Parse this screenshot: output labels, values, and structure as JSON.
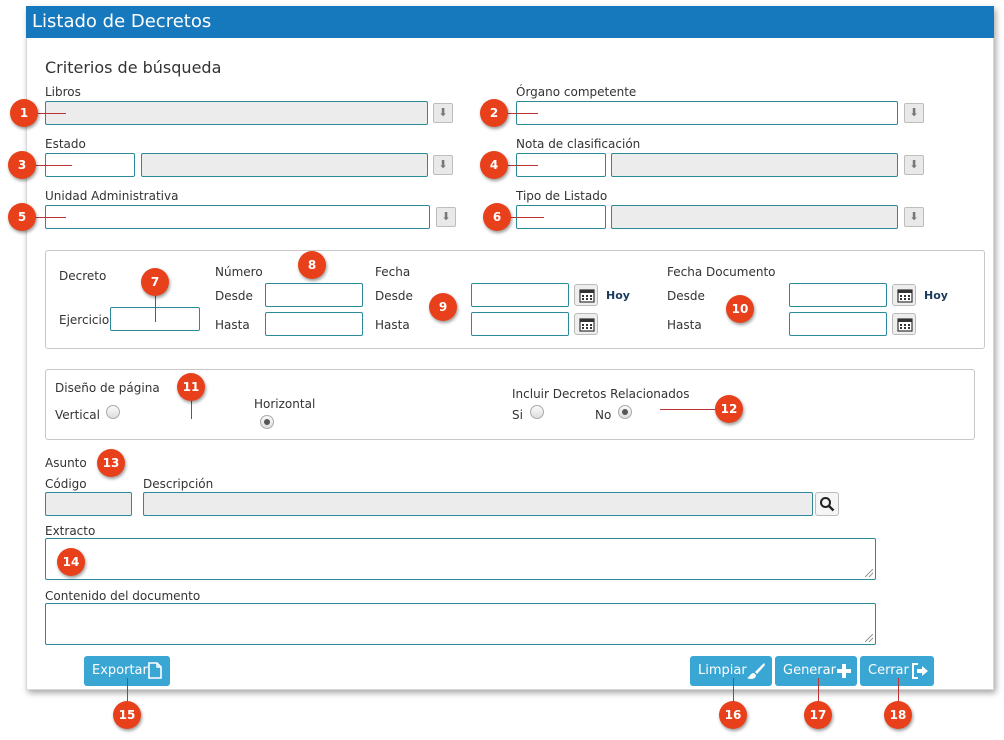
{
  "title": "Listado de Decretos",
  "section_title": "Criterios de búsqueda",
  "labels": {
    "libros": "Libros",
    "organo": "Órgano competente",
    "estado": "Estado",
    "nota": "Nota de clasificación",
    "unidad": "Unidad Administrativa",
    "tipo": "Tipo de Listado",
    "decreto": "Decreto",
    "ejercicio": "Ejercicio",
    "numero": "Número",
    "fecha": "Fecha",
    "fecha_doc": "Fecha Documento",
    "desde": "Desde",
    "hasta": "Hasta",
    "hoy": "Hoy",
    "diseno": "Diseño de página",
    "vertical": "Vertical",
    "horizontal": "Horizontal",
    "incluir": "Incluir Decretos Relacionados",
    "si": "Si",
    "no": "No",
    "asunto": "Asunto",
    "codigo": "Código",
    "descripcion": "Descripción",
    "extracto": "Extracto",
    "contenido": "Contenido del documento"
  },
  "buttons": {
    "exportar": "Exportar",
    "limpiar": "Limpiar",
    "generar": "Generar",
    "cerrar": "Cerrar"
  },
  "radios": {
    "layout_selected": "Horizontal",
    "related_selected": "No"
  },
  "badges": [
    "1",
    "2",
    "3",
    "4",
    "5",
    "6",
    "7",
    "8",
    "9",
    "10",
    "11",
    "12",
    "13",
    "14",
    "15",
    "16",
    "17",
    "18"
  ],
  "colors": {
    "header": "#1678bd",
    "button": "#3aa6d4",
    "badge": "#e8401a",
    "input_border": "#2a8a9a"
  }
}
